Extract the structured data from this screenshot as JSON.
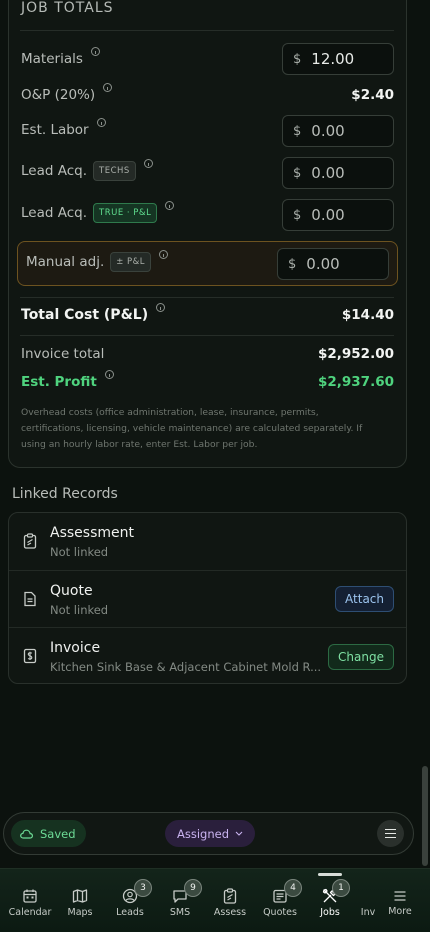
{
  "job_totals": {
    "title": "JOB TOTALS",
    "materials": {
      "label": "Materials",
      "currency": "$",
      "value": "12.00"
    },
    "overhead_profit": {
      "label": "O&P (20%)",
      "value": "$2.40"
    },
    "est_labor": {
      "label": "Est. Labor",
      "currency": "$",
      "placeholder": "0.00"
    },
    "lead_acq_techs": {
      "label": "Lead Acq.",
      "tag": "TECHS",
      "currency": "$",
      "placeholder": "0.00"
    },
    "lead_acq_true": {
      "label": "Lead Acq.",
      "tag": "TRUE · P&L",
      "currency": "$",
      "placeholder": "0.00"
    },
    "manual_adj": {
      "label": "Manual adj.",
      "tag": "± P&L",
      "currency": "$",
      "placeholder": "0.00"
    },
    "total_cost": {
      "label": "Total Cost (P&L)",
      "value": "$14.40"
    },
    "invoice_total": {
      "label": "Invoice total",
      "value": "$2,952.00"
    },
    "est_profit": {
      "label": "Est. Profit",
      "value": "$2,937.60"
    },
    "footnote": "Overhead costs (office administration, lease, insurance, permits, certifications, licensing, vehicle maintenance) are calculated separately. If using an hourly labor rate, enter Est. Labor per job."
  },
  "linked_records": {
    "heading": "Linked Records",
    "items": [
      {
        "title": "Assessment",
        "subtitle": "Not linked",
        "icon": "clipboard-icon"
      },
      {
        "title": "Quote",
        "subtitle": "Not linked",
        "icon": "document-icon",
        "action": "Attach"
      },
      {
        "title": "Invoice",
        "subtitle": "Kitchen Sink Base & Adjacent Cabinet Mold R...",
        "icon": "invoice-icon",
        "action": "Change"
      }
    ]
  },
  "status_bar": {
    "saved": "Saved",
    "assigned": "Assigned"
  },
  "bottom_nav": {
    "items": [
      {
        "label": "Calendar",
        "icon": "calendar-icon"
      },
      {
        "label": "Maps",
        "icon": "map-icon"
      },
      {
        "label": "Leads",
        "icon": "leads-icon",
        "badge": "3"
      },
      {
        "label": "SMS",
        "icon": "chat-icon",
        "badge": "9"
      },
      {
        "label": "Assess",
        "icon": "clipboard-icon"
      },
      {
        "label": "Quotes",
        "icon": "quotes-icon",
        "badge": "4"
      },
      {
        "label": "Jobs",
        "icon": "tools-icon",
        "badge": "1",
        "active": true
      },
      {
        "label": "Inv",
        "icon": "invoice-icon"
      },
      {
        "label": "More",
        "icon": "menu-icon"
      }
    ]
  },
  "colors": {
    "background": "#0c120e",
    "accent_green": "#4fd37e",
    "manual_border": "#6d5320",
    "assigned_purple": "#2a1f3c"
  }
}
